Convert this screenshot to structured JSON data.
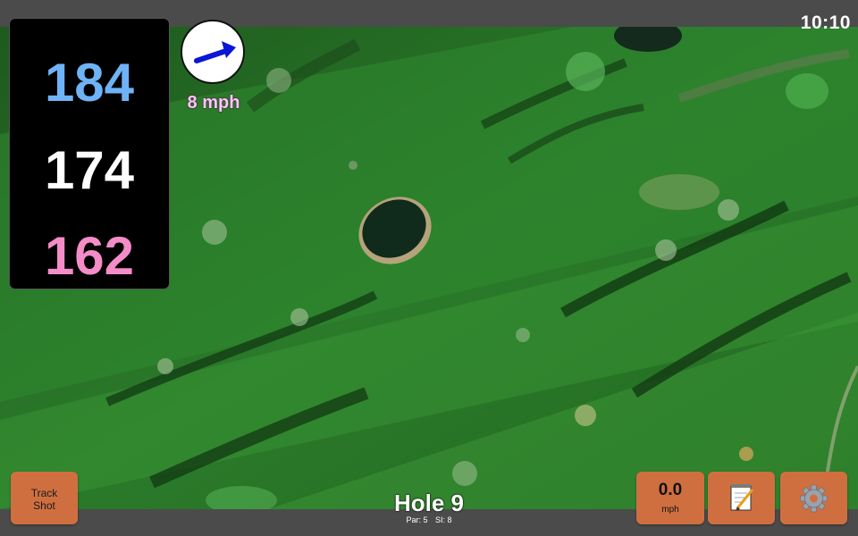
{
  "status": {
    "time": "10:10"
  },
  "distances": {
    "back": "184",
    "middle": "174",
    "front": "162"
  },
  "wind": {
    "speed_label": "8 mph",
    "icon": "wind-direction-arrow-icon",
    "direction": "east-northeast"
  },
  "hole": {
    "title": "Hole 9",
    "par": "Par: 5",
    "si": "SI: 8"
  },
  "buttons": {
    "track_shot": {
      "line1": "Track",
      "line2": "Shot"
    },
    "speed": {
      "value": "0.0",
      "unit": "mph"
    },
    "notes": {
      "icon": "notepad-icon"
    },
    "settings": {
      "icon": "gear-icon"
    }
  },
  "colors": {
    "back_distance": "#6fb3f7",
    "middle_distance": "#ffffff",
    "front_distance": "#f48cc8",
    "button": "#cf6f40",
    "wind_label": "#f6c9f2",
    "wind_arrow": "#0a16d6",
    "bar": "#4b4b4b"
  }
}
